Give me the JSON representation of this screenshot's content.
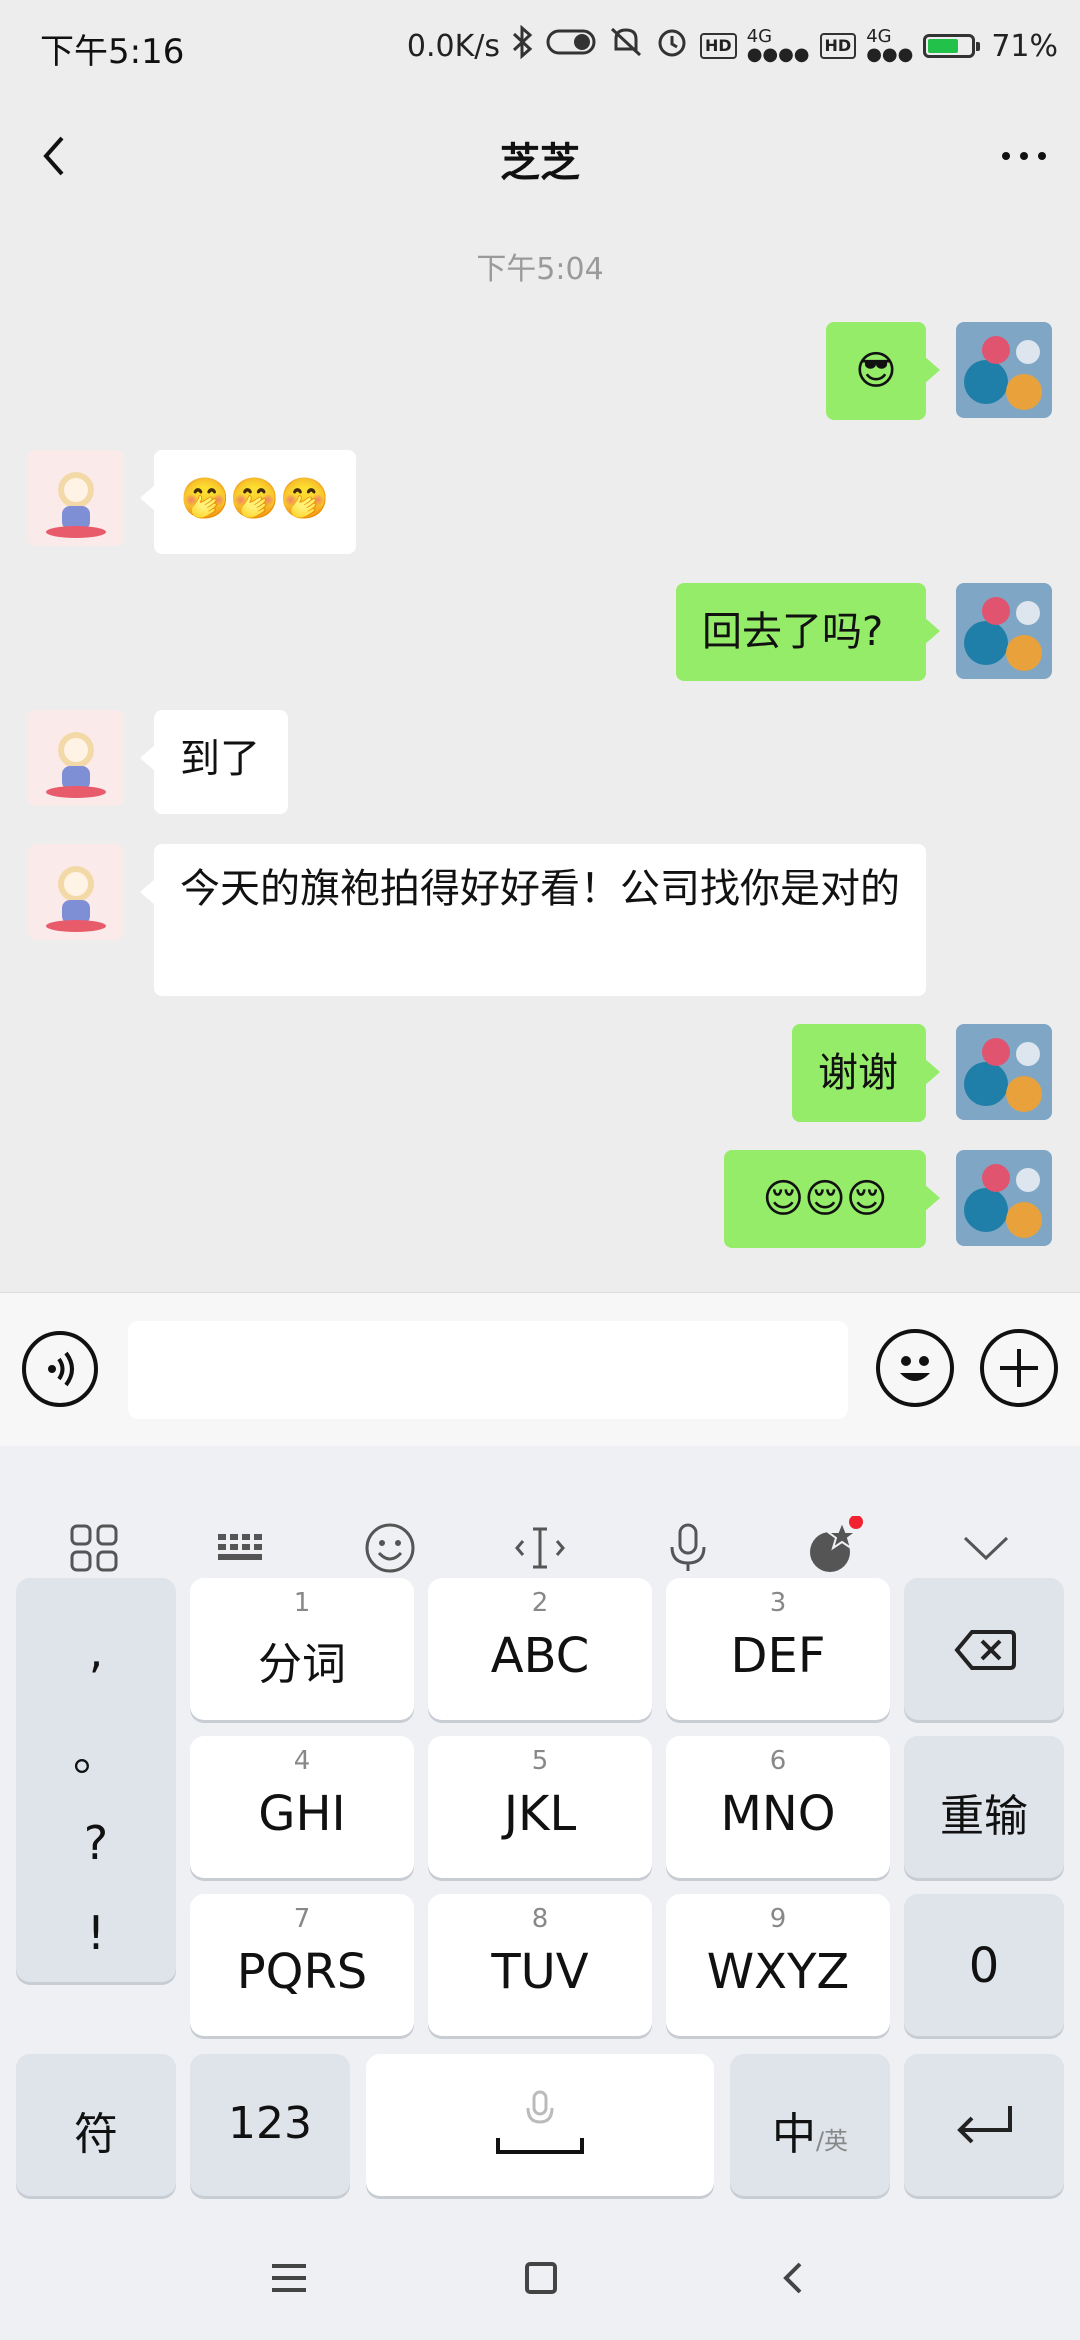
{
  "status": {
    "time": "下午5:16",
    "speed": "0.0K/s",
    "net1": "4G",
    "net2": "4G",
    "hd": "HD",
    "battery": "71%"
  },
  "header": {
    "title": "芝芝"
  },
  "chat": {
    "timestamp": "下午5:04",
    "messages": [
      {
        "from": "me",
        "text": "😎"
      },
      {
        "from": "them",
        "text": "🤭🤭🤭"
      },
      {
        "from": "me",
        "text": "回去了吗?"
      },
      {
        "from": "them",
        "text": "到了"
      },
      {
        "from": "them",
        "text": "今天的旗袍拍得好好看！公司找你是对的"
      },
      {
        "from": "me",
        "text": "谢谢"
      },
      {
        "from": "me",
        "text": "😌😌😌"
      }
    ]
  },
  "input": {
    "value": "",
    "placeholder": ""
  },
  "keyboard": {
    "toolbar": [
      "grid-icon",
      "keyboard-icon",
      "emoji-icon",
      "cursor-icon",
      "mic-icon",
      "skin-icon",
      "collapse-icon"
    ],
    "punct": [
      ",",
      "。",
      "?",
      "!"
    ],
    "keys": [
      {
        "num": "1",
        "label": "分词"
      },
      {
        "num": "2",
        "label": "ABC"
      },
      {
        "num": "3",
        "label": "DEF"
      },
      {
        "num": "4",
        "label": "GHI"
      },
      {
        "num": "5",
        "label": "JKL"
      },
      {
        "num": "6",
        "label": "MNO"
      },
      {
        "num": "7",
        "label": "PQRS"
      },
      {
        "num": "8",
        "label": "TUV"
      },
      {
        "num": "9",
        "label": "WXYZ"
      }
    ],
    "reenter": "重输",
    "zero": "0",
    "symbol": "符",
    "num123": "123",
    "lang_main": "中",
    "lang_sub": "/英"
  }
}
